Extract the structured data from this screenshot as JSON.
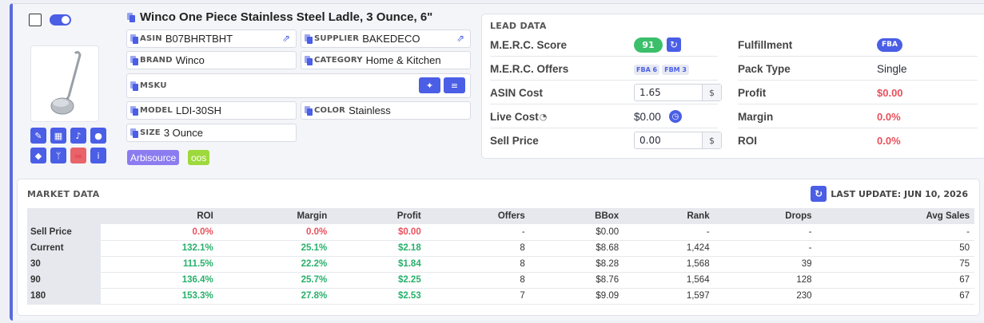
{
  "product": {
    "title": "Winco One Piece Stainless Steel Ladle, 3 Ounce, 6\"",
    "fields": {
      "asin": {
        "label": "ASIN",
        "value": "B07BHRTBHT"
      },
      "supplier": {
        "label": "SUPPLIER",
        "value": "BAKEDECO"
      },
      "brand": {
        "label": "BRAND",
        "value": "Winco"
      },
      "category": {
        "label": "CATEGORY",
        "value": "Home & Kitchen"
      },
      "msku": {
        "label": "MSKU",
        "value": ""
      },
      "model": {
        "label": "MODEL",
        "value": "LDI-30SH"
      },
      "color": {
        "label": "COLOR",
        "value": "Stainless"
      },
      "size": {
        "label": "SIZE",
        "value": "3 Ounce"
      }
    },
    "tags": [
      {
        "label": "Arbisource",
        "color": "#8b7cf0"
      },
      {
        "label": "oos",
        "color": "#9ed93c"
      }
    ]
  },
  "lead": {
    "title": "LEAD DATA",
    "merc_score": {
      "label": "M.E.R.C. Score",
      "value": "91"
    },
    "merc_offers": {
      "label": "M.E.R.C. Offers",
      "fba": "FBA 6",
      "fbm": "FBM 3"
    },
    "asin_cost": {
      "label": "ASIN Cost",
      "value": "1.65",
      "unit": "$"
    },
    "live_cost": {
      "label": "Live Cost",
      "value": "$0.00"
    },
    "sell_price": {
      "label": "Sell Price",
      "value": "0.00",
      "unit": "$"
    },
    "fulfillment": {
      "label": "Fulfillment",
      "value": "FBA"
    },
    "pack_type": {
      "label": "Pack Type",
      "value": "Single"
    },
    "profit": {
      "label": "Profit",
      "value": "$0.00"
    },
    "margin": {
      "label": "Margin",
      "value": "0.0%"
    },
    "roi": {
      "label": "ROI",
      "value": "0.0%"
    }
  },
  "market": {
    "title": "MARKET DATA",
    "last_update": "LAST UPDATE: JUN 10, 2026",
    "headers": [
      "",
      "ROI",
      "Margin",
      "Profit",
      "Offers",
      "BBox",
      "Rank",
      "Drops",
      "Avg Sales"
    ],
    "rows": [
      [
        "Sell Price",
        "0.0%",
        "0.0%",
        "$0.00",
        "-",
        "$0.00",
        "-",
        "-",
        "-"
      ],
      [
        "Current",
        "132.1%",
        "25.1%",
        "$2.18",
        "8",
        "$8.68",
        "1,424",
        "-",
        "50"
      ],
      [
        "30",
        "111.5%",
        "22.2%",
        "$1.84",
        "8",
        "$8.28",
        "1,568",
        "39",
        "75"
      ],
      [
        "90",
        "136.4%",
        "25.7%",
        "$2.25",
        "8",
        "$8.76",
        "1,564",
        "128",
        "67"
      ],
      [
        "180",
        "153.3%",
        "27.8%",
        "$2.53",
        "7",
        "$9.09",
        "1,597",
        "230",
        "67"
      ]
    ],
    "colors": {
      "negative": "#e8505b",
      "positive": "#27b06b"
    }
  }
}
